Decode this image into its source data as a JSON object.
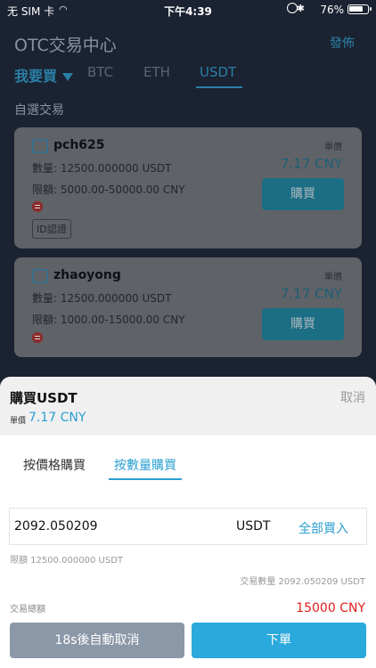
{
  "status_bar": {
    "carrier": "无 SIM 卡",
    "time": "下午4:39",
    "battery": "76%",
    "battery_level": 0.76
  },
  "header": {
    "title": "OTC交易中心",
    "publish": "發佈",
    "buy_tab": "我要買",
    "coins": [
      "BTC",
      "ETH",
      "USDT"
    ],
    "active_coin": "USDT"
  },
  "section": {
    "label": "自選交易"
  },
  "cards": [
    {
      "name": "pch625",
      "price_label": "單價",
      "price": "7.17 CNY",
      "quantity": "數量: 12500.000000 USDT",
      "limit": "限額: 5000.00-50000.00 CNY",
      "badge": "ID認證",
      "buy": "購買"
    },
    {
      "name": "zhaoyong",
      "price_label": "單價",
      "price": "7.17 CNY",
      "quantity": "數量: 12500.000000 USDT",
      "limit": "限額: 1000.00-15000.00 CNY",
      "buy": "購買"
    }
  ],
  "sheet": {
    "title": "購買USDT",
    "cancel": "取消",
    "unit_label": "單價",
    "unit_price": "7.17 CNY",
    "mode_tabs": [
      "按價格購買",
      "按數量購買"
    ],
    "active_mode": "按數量購買",
    "quantity_value": "2092.050209",
    "unit": "USDT",
    "buy_all": "全部買入",
    "limit": "限額 12500.000000 USDT",
    "trade_quantity": "交易數量 2092.050209 USDT",
    "total_label": "交易總額",
    "total_value": "15000 CNY",
    "auto_cancel": "18s後自動取消",
    "place_order": "下單"
  },
  "colors": {
    "accent": "#2a9fd0",
    "total": "#e0201f",
    "background": "#1b2231"
  }
}
